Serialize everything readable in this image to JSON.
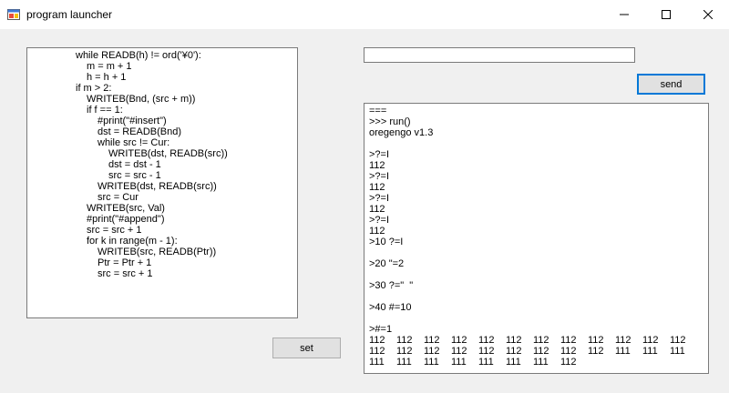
{
  "window": {
    "title": "program launcher"
  },
  "icons": {
    "app": "app-window-icon",
    "minimize": "minimize-icon",
    "maximize": "maximize-icon",
    "close": "close-icon"
  },
  "code": {
    "lines": [
      {
        "indent": 0,
        "text": "while READB(h) != ord('¥0'):"
      },
      {
        "indent": 1,
        "text": "m = m + 1"
      },
      {
        "indent": 1,
        "text": "h = h + 1"
      },
      {
        "indent": 0,
        "text": "if m > 2:"
      },
      {
        "indent": 1,
        "text": "WRITEB(Bnd, (src + m))"
      },
      {
        "indent": 1,
        "text": "if f == 1:"
      },
      {
        "indent": 2,
        "text": "#print(\"#insert\")"
      },
      {
        "indent": 2,
        "text": "dst = READB(Bnd)"
      },
      {
        "indent": 2,
        "text": "while src != Cur:"
      },
      {
        "indent": 3,
        "text": "WRITEB(dst, READB(src))"
      },
      {
        "indent": 3,
        "text": "dst = dst - 1"
      },
      {
        "indent": 3,
        "text": "src = src - 1"
      },
      {
        "indent": 2,
        "text": "WRITEB(dst, READB(src))"
      },
      {
        "indent": 2,
        "text": "src = Cur"
      },
      {
        "indent": 1,
        "text": "WRITEB(src, Val)"
      },
      {
        "indent": 1,
        "text": "#print(\"#append\")"
      },
      {
        "indent": 1,
        "text": "src = src + 1"
      },
      {
        "indent": 1,
        "text": "for k in range(m - 1):"
      },
      {
        "indent": 2,
        "text": "WRITEB(src, READB(Ptr))"
      },
      {
        "indent": 2,
        "text": "Ptr = Ptr + 1"
      },
      {
        "indent": 2,
        "text": "src = src + 1"
      }
    ]
  },
  "command_input": {
    "value": ""
  },
  "buttons": {
    "send": "send",
    "set": "set"
  },
  "output": {
    "lines": [
      "===",
      ">>> run()",
      "oregengo v1.3",
      "",
      ">?=I",
      "112",
      ">?=I",
      "112",
      ">?=I",
      "112",
      ">?=I",
      "112",
      ">10 ?=I",
      "",
      ">20 \"=2",
      "",
      ">30 ?=\"  \"",
      "",
      ">40 #=10",
      "",
      ">#=1"
    ],
    "number_rows": [
      [
        "112",
        "112",
        "112",
        "112",
        "112",
        "112",
        "112",
        "112",
        "112",
        "112",
        "112",
        "112"
      ],
      [
        "112",
        "112",
        "112",
        "112",
        "112",
        "112",
        "112",
        "112",
        "112",
        "111",
        "111",
        "111"
      ],
      [
        "111",
        "111",
        "111",
        "111",
        "111",
        "111",
        "111",
        "112"
      ]
    ]
  }
}
